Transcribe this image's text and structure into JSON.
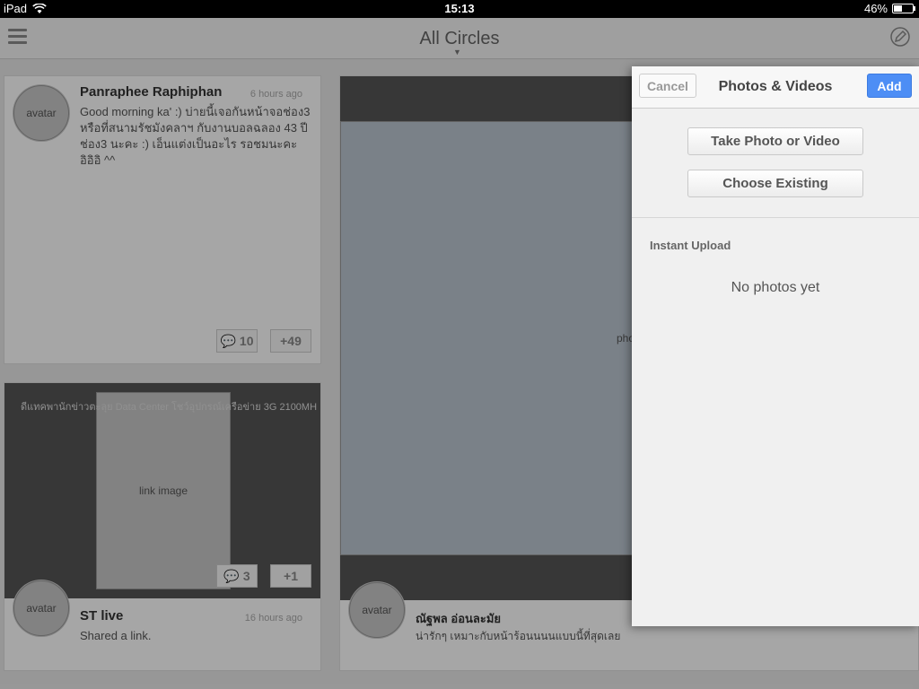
{
  "status_bar": {
    "device": "iPad",
    "time": "15:13",
    "battery": "46%"
  },
  "nav": {
    "title": "All Circles"
  },
  "posts": [
    {
      "author": "Panraphee Raphiphan",
      "time": "6 hours ago",
      "text": "Good morning ka' :) บ่ายนี้เจอกันหน้าจอช่อง3 หรือที่สนามรัชมังคลาฯ กับงานบอลฉลอง 43 ปีช่อง3 นะคะ :) เอ็นแต่งเป็นอะไร รอชมนะคะ อิอิอิ ^^",
      "comments": "10",
      "plus": "+49"
    },
    {
      "author": "ST live",
      "time": "16 hours ago",
      "text": "Shared a link.",
      "link_title": "ดีแทคพานักข่าวตะลุย Data Center โชว์อุปกรณ์เครือข่าย 3G 2100MH...",
      "comments": "3",
      "plus": "+1"
    },
    {
      "author": "ณัฐพล อ่อนละมัย",
      "text": "น่ารักๆ เหมาะกับหน้าร้อนนนนแบบนี้ที่สุดเลย"
    }
  ],
  "popover": {
    "title": "Photos & Videos",
    "cancel_label": "Cancel",
    "add_label": "Add",
    "take_label": "Take Photo or Video",
    "choose_label": "Choose Existing",
    "section_label": "Instant Upload",
    "empty_text": "No photos yet"
  },
  "colors": {
    "accent": "#4d8ef5"
  }
}
